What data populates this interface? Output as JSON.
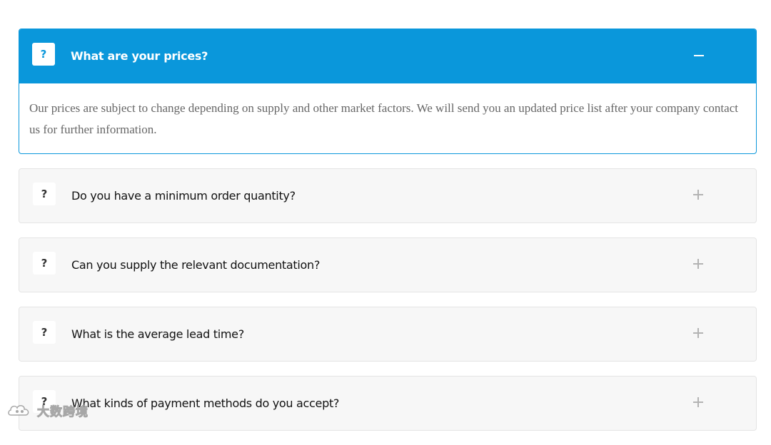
{
  "faq": {
    "badge": "?",
    "items": [
      {
        "question": "What are your prices?",
        "answer": "Our prices are subject to change depending on supply and other market factors. We will send you an updated price list after your company contact us for further information.",
        "expanded": true
      },
      {
        "question": "Do you have a minimum order quantity?",
        "expanded": false
      },
      {
        "question": "Can you supply the relevant documentation?",
        "expanded": false
      },
      {
        "question": "What is the average lead time?",
        "expanded": false
      },
      {
        "question": "What kinds of payment methods do you accept?",
        "expanded": false
      }
    ]
  },
  "watermark": {
    "text": "大数跨境",
    "logo": "cloud-logo"
  },
  "colors": {
    "accent": "#0a97db",
    "closed_bg": "#f7f7f7",
    "answer_text": "#666666",
    "toggle_icon": "#b3b3b3"
  }
}
